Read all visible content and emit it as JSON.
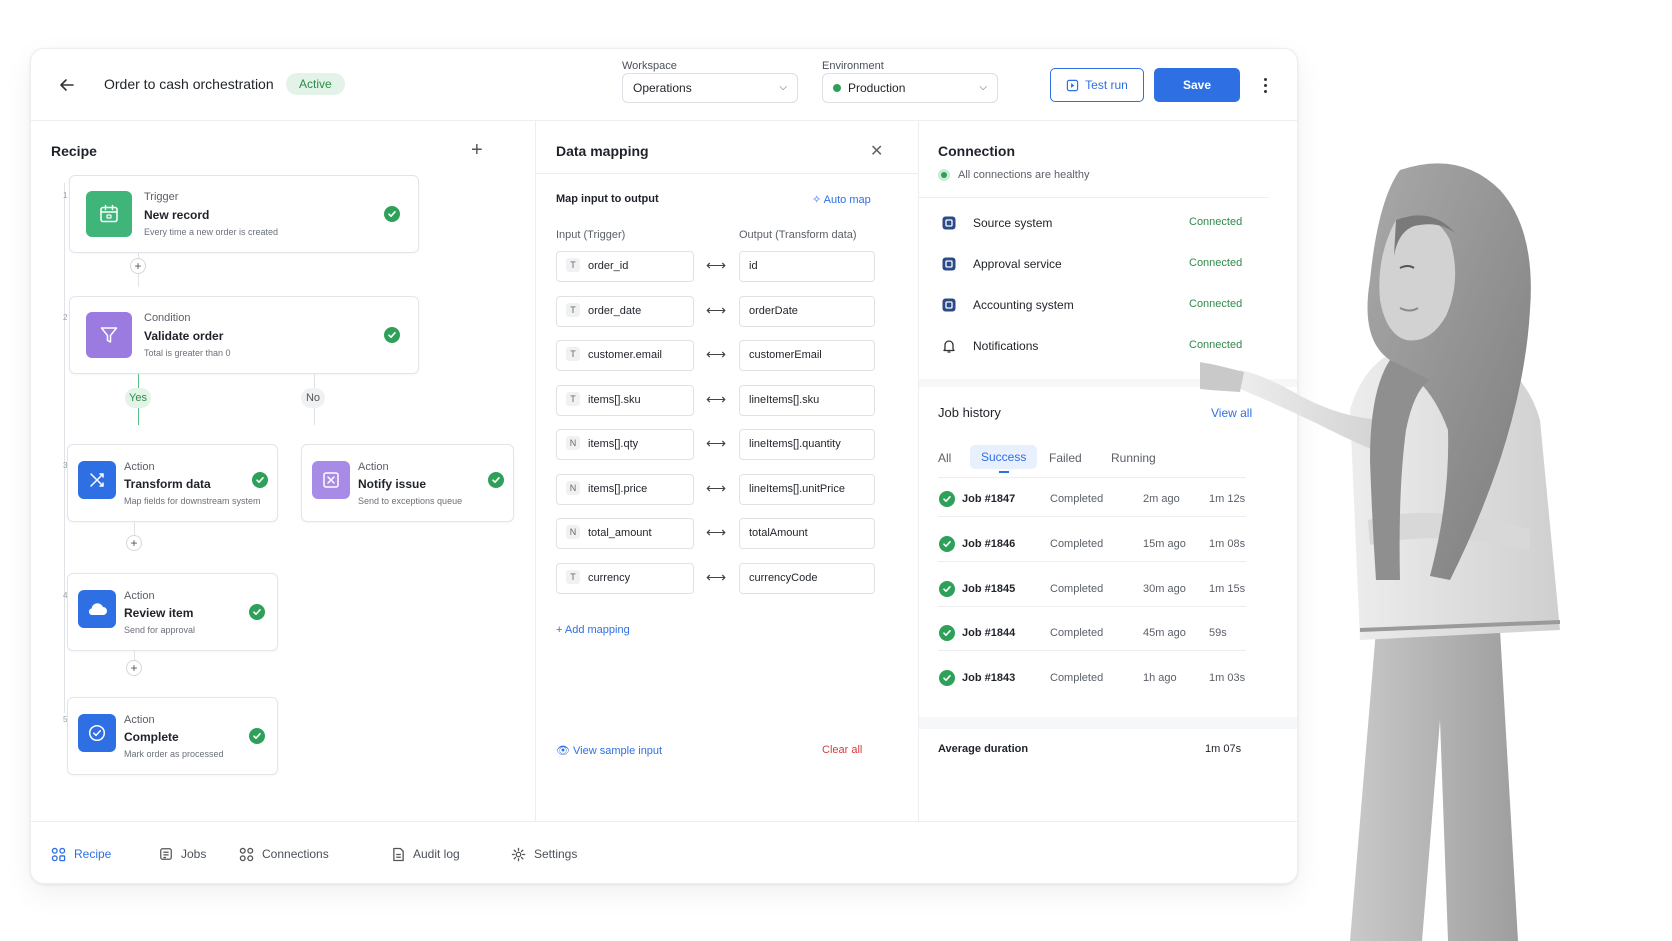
{
  "header": {
    "title": "Order to cash orchestration",
    "status": "Active",
    "workspace_label": "Workspace",
    "workspace_value": "Operations",
    "environment_label": "Environment",
    "environment_value": "Production",
    "test_run_label": "Test run",
    "save_label": "Save"
  },
  "recipe": {
    "title": "Recipe",
    "steps": [
      {
        "no": "1",
        "kind": "Trigger",
        "name": "New record",
        "desc": "Every time a new order is created",
        "icon": "calendar-icon",
        "color": "#3fb57a"
      },
      {
        "no": "2",
        "kind": "Condition",
        "name": "Validate order",
        "desc": "Total is greater than 0",
        "icon": "filter-icon",
        "color": "#9b7be0"
      },
      {
        "no": "3",
        "kind": "Action",
        "name": "Transform data",
        "desc": "Map fields for downstream system",
        "icon": "transform-icon",
        "color": "#2f6fe4"
      },
      {
        "no": "",
        "kind": "Action",
        "name": "Notify issue",
        "desc": "Send to exceptions queue",
        "icon": "close-box-icon",
        "color": "#9b7be0"
      },
      {
        "no": "4",
        "kind": "Action",
        "name": "Review item",
        "desc": "Send for approval",
        "icon": "cloud-icon",
        "color": "#2f6fe4"
      },
      {
        "no": "5",
        "kind": "Action",
        "name": "Complete",
        "desc": "Mark order as processed",
        "icon": "check-circle-icon",
        "color": "#2f6fe4"
      }
    ],
    "branch_yes": "Yes",
    "branch_no": "No"
  },
  "mapping": {
    "title": "Data mapping",
    "subtitle": "Map input to output",
    "auto_map": "Auto map",
    "input_header": "Input (Trigger)",
    "output_header": "Output (Transform data)",
    "rows": [
      {
        "type": "T",
        "input": "order_id",
        "output": "id"
      },
      {
        "type": "T",
        "input": "order_date",
        "output": "orderDate"
      },
      {
        "type": "T",
        "input": "customer.email",
        "output": "customerEmail"
      },
      {
        "type": "T",
        "input": "items[].sku",
        "output": "lineItems[].sku"
      },
      {
        "type": "N",
        "input": "items[].qty",
        "output": "lineItems[].quantity"
      },
      {
        "type": "N",
        "input": "items[].price",
        "output": "lineItems[].unitPrice"
      },
      {
        "type": "N",
        "input": "total_amount",
        "output": "totalAmount"
      },
      {
        "type": "T",
        "input": "currency",
        "output": "currencyCode"
      }
    ],
    "add_mapping": "Add mapping",
    "view_sample": "View sample input",
    "clear_all": "Clear all"
  },
  "connection": {
    "title": "Connection",
    "health": "All connections are healthy",
    "items": [
      {
        "name": "Source system",
        "status": "Connected"
      },
      {
        "name": "Approval service",
        "status": "Connected"
      },
      {
        "name": "Accounting system",
        "status": "Connected"
      },
      {
        "name": "Notifications",
        "status": "Connected"
      }
    ]
  },
  "jobs": {
    "title": "Job history",
    "view_all": "View all",
    "tabs": [
      "All",
      "Success",
      "Failed",
      "Running"
    ],
    "rows": [
      {
        "id": "Job #1847",
        "status": "Completed",
        "when": "2m ago",
        "dur": "1m 12s"
      },
      {
        "id": "Job #1846",
        "status": "Completed",
        "when": "15m ago",
        "dur": "1m 08s"
      },
      {
        "id": "Job #1845",
        "status": "Completed",
        "when": "30m ago",
        "dur": "1m 15s"
      },
      {
        "id": "Job #1844",
        "status": "Completed",
        "when": "45m ago",
        "dur": "59s"
      },
      {
        "id": "Job #1843",
        "status": "Completed",
        "when": "1h ago",
        "dur": "1m 03s"
      }
    ],
    "avg_label": "Average duration",
    "avg_value": "1m 07s"
  },
  "nav": [
    "Recipe",
    "Jobs",
    "Connections",
    "Audit log",
    "Settings"
  ],
  "colors": {
    "accent": "#2f6fe4",
    "success": "#2ea05a",
    "danger": "#d93b3b"
  }
}
